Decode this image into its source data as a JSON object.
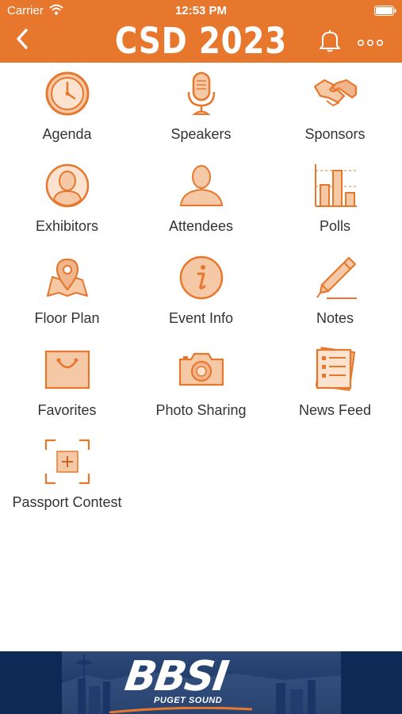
{
  "status_bar": {
    "carrier": "Carrier",
    "time": "12:53 PM"
  },
  "header": {
    "title": "CSD 2023",
    "bg_color": "#e8772e"
  },
  "menu": {
    "agenda": "Agenda",
    "speakers": "Speakers",
    "sponsors": "Sponsors",
    "exhibitors": "Exhibitors",
    "attendees": "Attendees",
    "polls": "Polls",
    "floor_plan": "Floor Plan",
    "event_info": "Event Info",
    "notes": "Notes",
    "favorites": "Favorites",
    "photo_sharing": "Photo Sharing",
    "news_feed": "News Feed",
    "passport_contest": "Passport Contest"
  },
  "banner": {
    "logo": "BBSI",
    "subtitle": "PUGET SOUND"
  },
  "colors": {
    "accent": "#e8772e",
    "icon_fill": "#f5c9a6",
    "icon_stroke": "#e8772e"
  }
}
